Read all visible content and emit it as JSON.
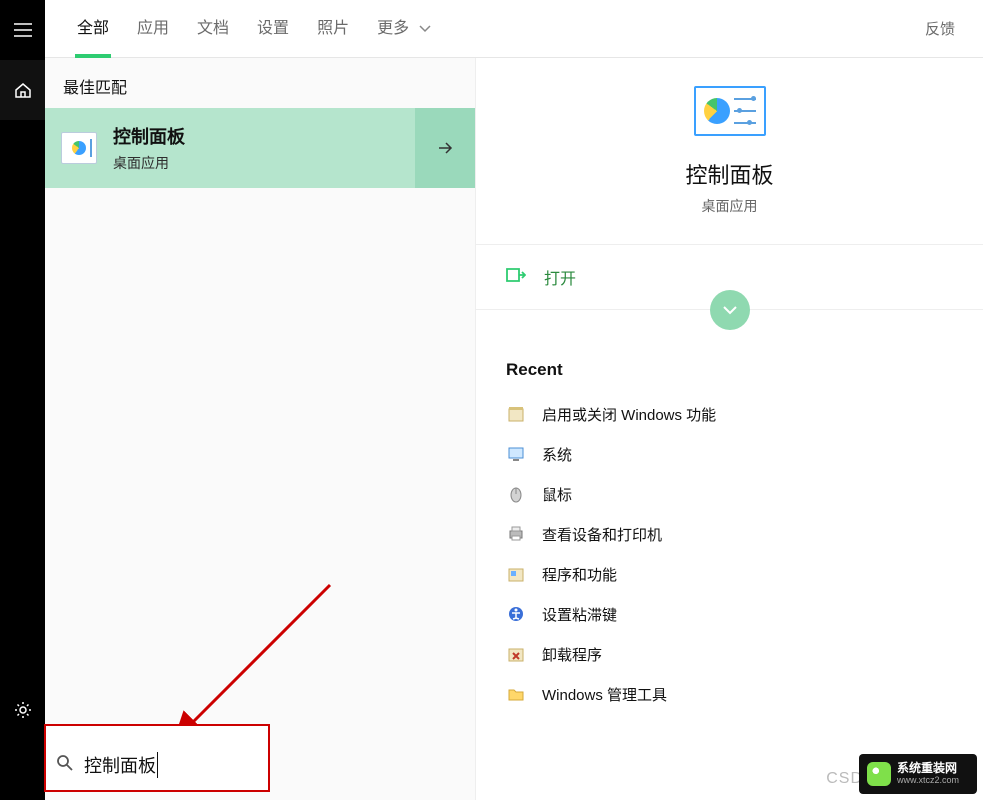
{
  "tabs": {
    "items": [
      "全部",
      "应用",
      "文档",
      "设置",
      "照片",
      "更多"
    ],
    "active_index": 0,
    "feedback": "反馈"
  },
  "results": {
    "section_label": "最佳匹配",
    "best": {
      "title": "控制面板",
      "subtitle": "桌面应用"
    }
  },
  "preview": {
    "title": "控制面板",
    "subtitle": "桌面应用",
    "open_label": "打开",
    "recent_label": "Recent",
    "recent_items": [
      {
        "label": "启用或关闭 Windows 功能",
        "icon": "feature-box-icon"
      },
      {
        "label": "系统",
        "icon": "system-icon"
      },
      {
        "label": "鼠标",
        "icon": "mouse-icon"
      },
      {
        "label": "查看设备和打印机",
        "icon": "printer-icon"
      },
      {
        "label": "程序和功能",
        "icon": "programs-icon"
      },
      {
        "label": "设置粘滞键",
        "icon": "accessibility-icon"
      },
      {
        "label": "卸载程序",
        "icon": "uninstall-icon"
      },
      {
        "label": "Windows 管理工具",
        "icon": "folder-icon"
      }
    ]
  },
  "search": {
    "value": "控制面板"
  },
  "watermark": {
    "csd": "CSD",
    "brand": "系统重装网",
    "url": "www.xtcz2.com"
  }
}
